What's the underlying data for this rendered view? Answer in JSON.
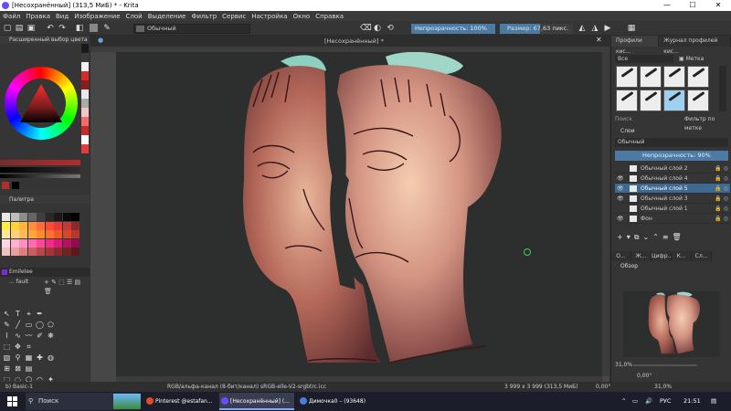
{
  "window": {
    "title": "[Несохранённый]  (313,5 МиБ)  * - Krita",
    "minimize": "—",
    "maximize": "☐",
    "close": "✕"
  },
  "menu": [
    "Файл",
    "Правка",
    "Вид",
    "Изображение",
    "Слой",
    "Выделение",
    "Фильтр",
    "Сервис",
    "Настройка",
    "Окно",
    "Справка"
  ],
  "toolbar": {
    "blend_mode": "Обычный",
    "opacity_label": "Непрозрачность: 100%",
    "size_label": "Размер: 67,63 пикс.",
    "size_fraction": 0.55
  },
  "left_dock": {
    "color_title": "Расширенный выбор цвета",
    "palette_title": "Палитра",
    "palette_name": "Emilelee",
    "palette_row": "... fault"
  },
  "canvas_tab": {
    "label": "[Несохранённый] *",
    "close": "✕"
  },
  "right_dock": {
    "tabs": [
      "Профили кис...",
      "Журнал профилей кис..."
    ],
    "brush_filter": "Все",
    "tag_button": "Метка",
    "search_placeholder": "Поиск",
    "filter_tag": "Фильтр по метке",
    "layers_title": "Слои",
    "layer_blend": "Обычный",
    "layer_opacity": "Непрозрачность: 90%",
    "layers": [
      {
        "name": "Обычный слой 2",
        "selected": false,
        "visible": false
      },
      {
        "name": "Обычный слой 4",
        "selected": false,
        "visible": true
      },
      {
        "name": "Обычный слой 5",
        "selected": true,
        "visible": true
      },
      {
        "name": "Обычный слой 3",
        "selected": false,
        "visible": true
      },
      {
        "name": "Обычный слой 1",
        "selected": false,
        "visible": false
      },
      {
        "name": "Фон",
        "selected": false,
        "visible": true
      }
    ],
    "bottom_tabs": [
      "О...",
      "Ж...",
      "Цифр...",
      "К...",
      "Сл..."
    ],
    "overview_title": "Обзор",
    "zoom": "31,0%",
    "rotation": "0,00°"
  },
  "statusbar": {
    "brush": "b) Basic-1",
    "color_profile": "RGB/альфа-канал (8-бит/канал)  sRGB-elle-V2-srgbtrc.icc",
    "dimensions": "3 999 x 3 999 (313,5 МиБ)",
    "angle": "0,00°",
    "zoom": "31,0%"
  },
  "taskbar": {
    "search": "Поиск",
    "apps": [
      {
        "label": "Pinterest @estafan...",
        "color": "#e04b2b"
      },
      {
        "label": "[Несохранённый] (...",
        "color": "#6a4cff"
      },
      {
        "label": "Димочка0 – (93648)",
        "color": "#4a7dd9"
      }
    ],
    "lang": "РУС",
    "time": "21:51"
  },
  "colors": {
    "accent": "#4b7aa3",
    "fg_color": "#b52b2b",
    "bg_dark": "#2d2f2e"
  }
}
